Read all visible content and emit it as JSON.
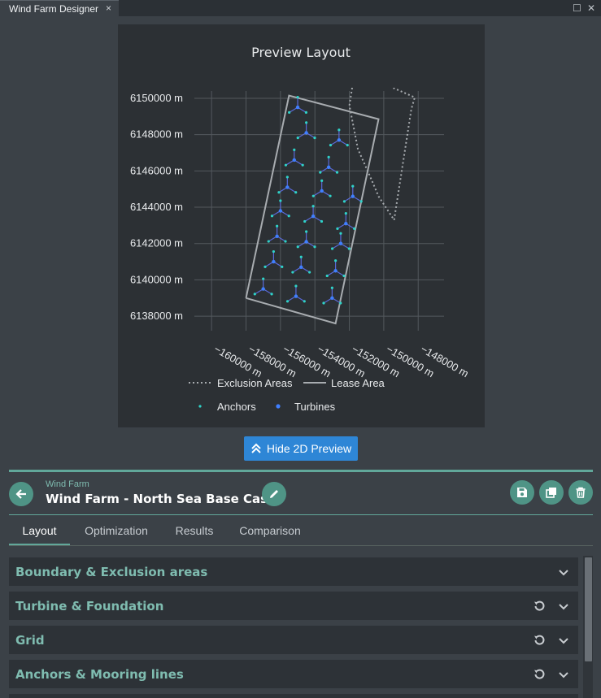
{
  "window": {
    "tab_title": "Wind Farm Designer",
    "close_glyph": "×",
    "restore_glyph": "☐",
    "close_window_glyph": "✕"
  },
  "preview": {
    "chart_data": {
      "type": "scatter",
      "title": "Preview Layout",
      "x_unit": "m",
      "y_unit": "m",
      "xlim": [
        -161000,
        -146500
      ],
      "ylim": [
        6137200,
        6150400
      ],
      "x_ticks": [
        -160000,
        -158000,
        -156000,
        -154000,
        -152000,
        -150000,
        -148000
      ],
      "x_tick_labels": [
        "−160000 m",
        "−158000 m",
        "−156000 m",
        "−154000 m",
        "−152000 m",
        "−150000 m",
        "−148000 m"
      ],
      "y_ticks": [
        6138000,
        6140000,
        6142000,
        6144000,
        6146000,
        6148000,
        6150000
      ],
      "y_tick_labels": [
        "6138000 m",
        "6140000 m",
        "6142000 m",
        "6144000 m",
        "6146000 m",
        "6148000 m",
        "6150000 m"
      ],
      "grid": true,
      "legend_position": "bottom",
      "legend": [
        {
          "label": "Exclusion Areas",
          "style": "dotted-line",
          "color": "#a8acb0"
        },
        {
          "label": "Lease Area",
          "style": "solid-line",
          "color": "#a8acb0"
        },
        {
          "label": "Anchors",
          "style": "small-dot",
          "color": "#2fd3c8"
        },
        {
          "label": "Turbines",
          "style": "dot",
          "color": "#3f7fff"
        }
      ],
      "lease_area": [
        [
          -158000,
          6139000
        ],
        [
          -155500,
          6150150
        ],
        [
          -150300,
          6148850
        ],
        [
          -152800,
          6137600
        ],
        [
          -158000,
          6139000
        ]
      ],
      "exclusion_areas": [
        [
          [
            -151800,
            6150800
          ],
          [
            -152000,
            6149600
          ],
          [
            -151500,
            6147200
          ],
          [
            -150800,
            6145700
          ],
          [
            -150300,
            6144600
          ],
          [
            -149400,
            6143300
          ],
          [
            -148400,
            6149400
          ],
          [
            -148200,
            6150050
          ],
          [
            -150000,
            6150800
          ]
        ]
      ],
      "turbines": [
        [
          -155000,
          6149500
        ],
        [
          -154500,
          6148100
        ],
        [
          -152600,
          6147700
        ],
        [
          -155200,
          6146600
        ],
        [
          -153200,
          6146200
        ],
        [
          -155600,
          6145100
        ],
        [
          -153600,
          6144900
        ],
        [
          -151800,
          6144600
        ],
        [
          -156000,
          6143800
        ],
        [
          -154100,
          6143500
        ],
        [
          -152200,
          6143100
        ],
        [
          -156200,
          6142400
        ],
        [
          -154500,
          6142100
        ],
        [
          -152500,
          6142000
        ],
        [
          -156400,
          6141000
        ],
        [
          -154800,
          6140700
        ],
        [
          -152800,
          6140500
        ],
        [
          -157000,
          6139500
        ],
        [
          -155100,
          6139100
        ],
        [
          -153000,
          6139000
        ]
      ],
      "anchor_offsets": [
        [
          0,
          560
        ],
        [
          490,
          -280
        ],
        [
          -490,
          -280
        ]
      ]
    }
  },
  "hide_preview_button": {
    "label": "Hide 2D Preview"
  },
  "wind_farm": {
    "caption": "Wind Farm",
    "title": "Wind Farm - North Sea Base Case"
  },
  "tabs": [
    {
      "label": "Layout",
      "active": true
    },
    {
      "label": "Optimization",
      "active": false
    },
    {
      "label": "Results",
      "active": false
    },
    {
      "label": "Comparison",
      "active": false
    }
  ],
  "sections": [
    {
      "title": "Boundary & Exclusion areas",
      "has_reset": false
    },
    {
      "title": "Turbine & Foundation",
      "has_reset": true
    },
    {
      "title": "Grid",
      "has_reset": true
    },
    {
      "title": "Anchors & Mooring lines",
      "has_reset": true
    }
  ],
  "icons": {
    "back": "arrow-left-icon",
    "edit": "pencil-icon",
    "save": "floppy-disk-icon",
    "duplicate": "copy-icon",
    "delete": "trash-icon",
    "reset": "reset-icon",
    "expand": "chevron-down-icon",
    "collapse_preview": "double-chevron-up-icon"
  },
  "colors": {
    "accent": "#61a79a",
    "accent_button": "#4f9486",
    "primary_button": "#2e86d6",
    "section_title": "#7fbcb0",
    "anchor": "#2fd3c8",
    "turbine": "#3f7fff",
    "mooring": "#5a6ad8"
  }
}
